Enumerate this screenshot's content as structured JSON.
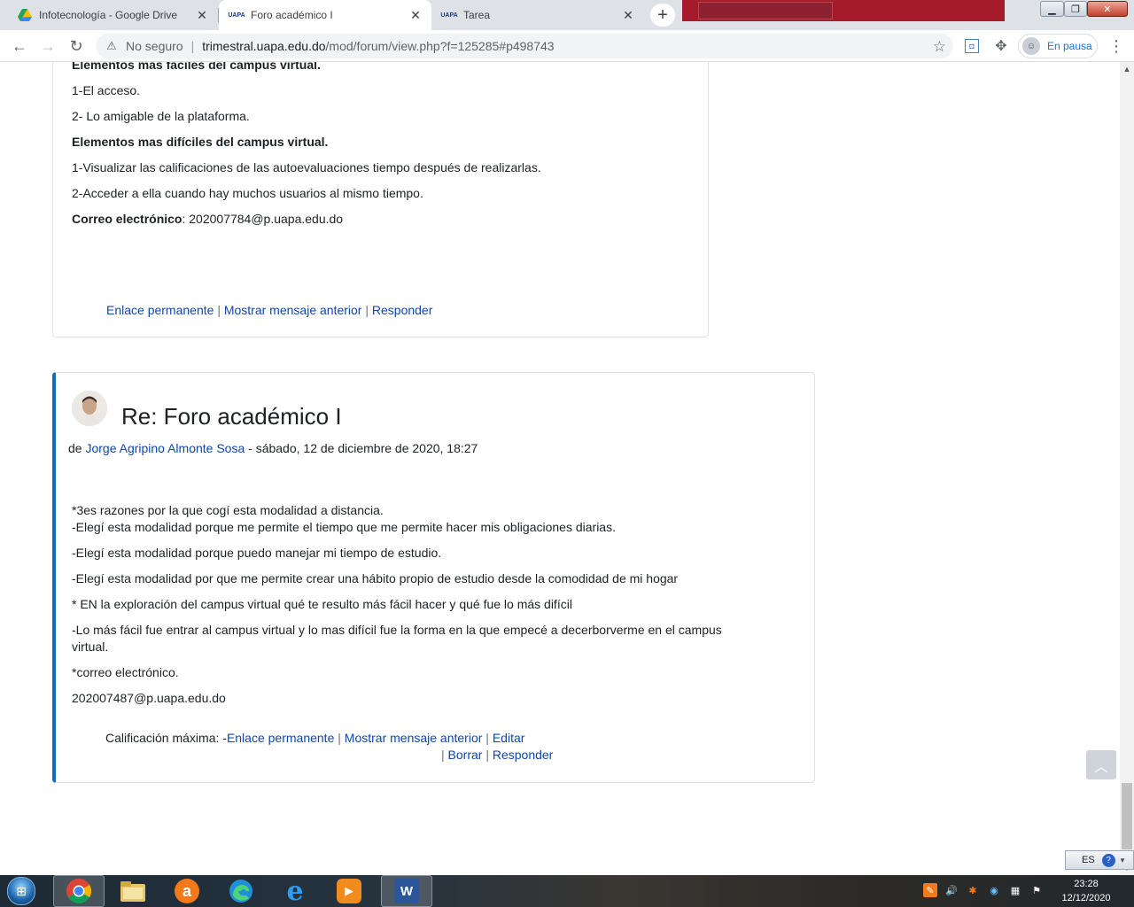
{
  "browser": {
    "tabs": [
      {
        "title": "Infotecnología - Google Drive",
        "icon": "google-drive-icon",
        "active": false
      },
      {
        "title": "Foro académico I",
        "icon": "uapa-icon",
        "active": true
      },
      {
        "title": "Tarea",
        "icon": "uapa-icon",
        "active": false
      }
    ],
    "favicon_text": "UAPA",
    "security_label": "No seguro",
    "url_host": "trimestral.uapa.edu.do",
    "url_path": "/mod/forum/view.php?f=125285#p498743",
    "profile_label": "En pausa"
  },
  "post1": {
    "lines": [
      {
        "bold": "Elementos mas fáciles del campus virtual.",
        "text": ""
      },
      {
        "bold": "",
        "text": "1-El acceso."
      },
      {
        "bold": "",
        "text": "2- Lo amigable de la plataforma."
      },
      {
        "bold": "Elementos mas difíciles del campus virtual.",
        "text": ""
      },
      {
        "bold": "",
        "text": "1-Visualizar las calificaciones de las autoevaluaciones tiempo después de realizarlas."
      },
      {
        "bold": "",
        "text": "2-Acceder a ella cuando hay muchos usuarios al mismo tiempo."
      },
      {
        "bold": "Correo electrónico",
        "text": ": 202007784@p.uapa.edu.do"
      }
    ],
    "commands": {
      "permalink": "Enlace permanente",
      "show_parent": "Mostrar mensaje anterior",
      "reply": "Responder",
      "separator": "|"
    }
  },
  "post2": {
    "subject": "Re: Foro académico I",
    "by_prefix": "de",
    "author": "Jorge Agripino Almonte Sosa",
    "date": "- sábado, 12 de diciembre de 2020, 18:27",
    "body": [
      "*3es razones por la que cogí esta modalidad a distancia.",
      "-Elegí esta modalidad porque me permite el tiempo que me permite hacer mis obligaciones diarias.",
      "-Elegí esta modalidad porque puedo manejar mi tiempo de estudio.",
      "-Elegí esta modalidad por que me permite crear una hábito propio de estudio desde la comodidad de mi hogar",
      "* EN la exploración del campus virtual qué te resulto más fácil hacer y qué fue lo más difícil",
      "-Lo más fácil fue entrar al campus virtual y lo mas difícil fue la forma en la que empecé a decerborverme en el campus",
      "virtual.",
      "*correo electrónico.",
      "202007487@p.uapa.edu.do"
    ],
    "rating_label": "Calificación máxima: -",
    "commands": {
      "permalink": "Enlace permanente",
      "show_parent": "Mostrar mensaje anterior",
      "edit": "Editar",
      "delete": "Borrar",
      "reply": "Responder",
      "separator": "|"
    }
  },
  "taskbar": {
    "language": "ES",
    "help": "?",
    "time": "23:28",
    "date": "12/12/2020",
    "word_letter": "W",
    "ie_letter": "e",
    "avast_letter": "a"
  }
}
